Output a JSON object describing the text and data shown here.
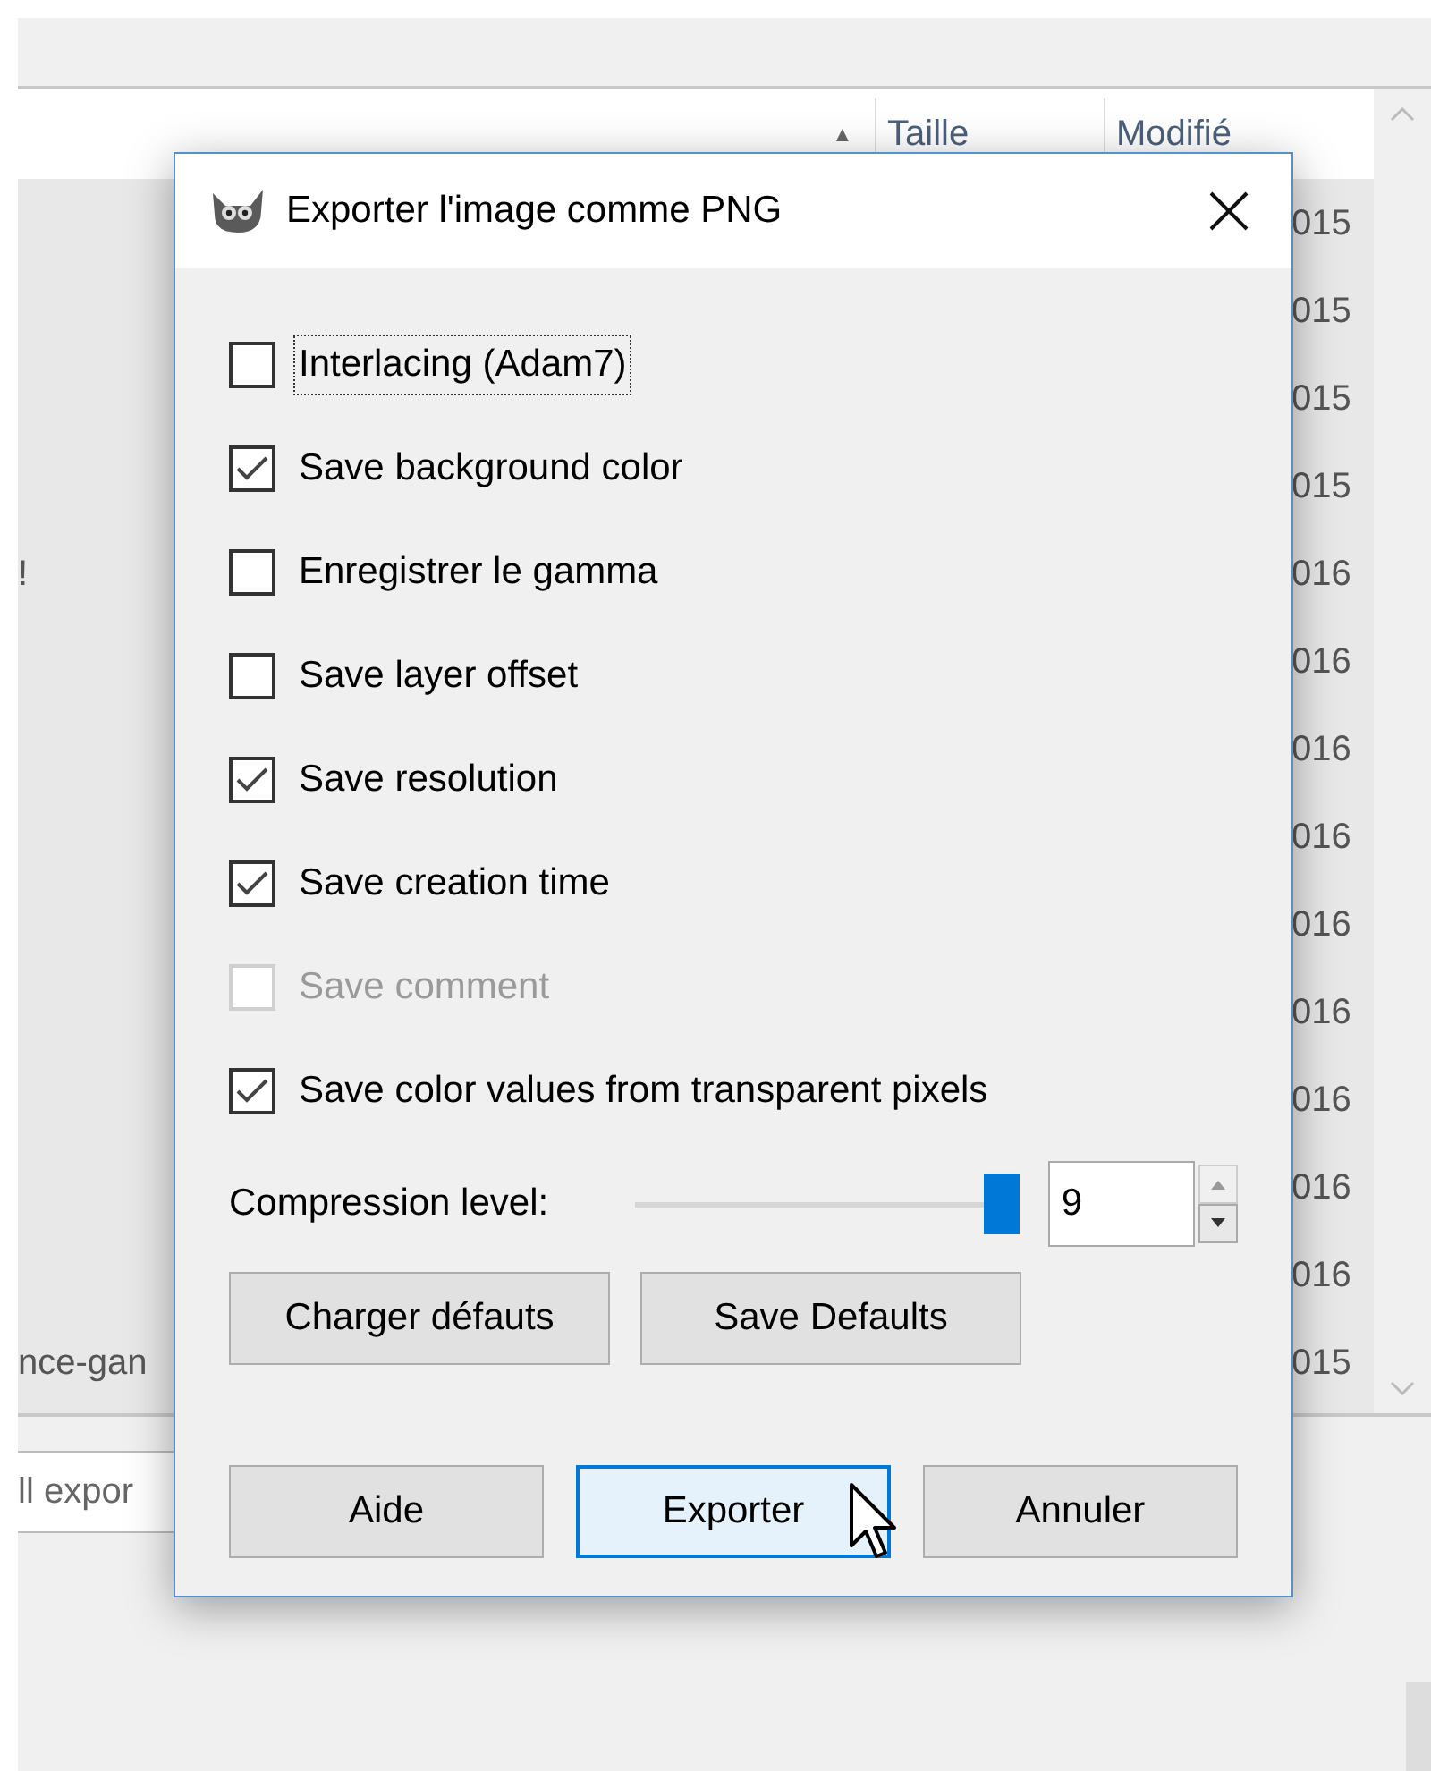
{
  "file_list": {
    "sort_arrow": "▲",
    "columns": [
      "Taille",
      "Modifié"
    ],
    "rows": [
      {
        "date": "015"
      },
      {
        "date": "015"
      },
      {
        "date": "015"
      },
      {
        "date": "015"
      },
      {
        "name": "!",
        "date": "016"
      },
      {
        "date": "016"
      },
      {
        "date": "016"
      },
      {
        "date": "016"
      },
      {
        "date": "016"
      },
      {
        "date": "016"
      },
      {
        "date": "016"
      },
      {
        "date": "016"
      },
      {
        "date": "016"
      },
      {
        "name": "nce-gan",
        "date": "015"
      }
    ],
    "filter_field": {
      "value": "ll expor"
    }
  },
  "dialog": {
    "title": "Exporter l'image comme PNG",
    "options": [
      {
        "label": "Interlacing (Adam7)",
        "checked": false,
        "disabled": false,
        "focused": true
      },
      {
        "label": "Save background color",
        "checked": true,
        "disabled": false,
        "focused": false
      },
      {
        "label": "Enregistrer le gamma",
        "checked": false,
        "disabled": false,
        "focused": false
      },
      {
        "label": "Save layer offset",
        "checked": false,
        "disabled": false,
        "focused": false
      },
      {
        "label": "Save resolution",
        "checked": true,
        "disabled": false,
        "focused": false
      },
      {
        "label": "Save creation time",
        "checked": true,
        "disabled": false,
        "focused": false
      },
      {
        "label": "Save comment",
        "checked": false,
        "disabled": true,
        "focused": false
      },
      {
        "label": "Save color values from transparent pixels",
        "checked": true,
        "disabled": false,
        "focused": false
      }
    ],
    "compression": {
      "label": "Compression level:",
      "level": 1,
      "value": "9"
    },
    "defaults_buttons": [
      "Charger défauts",
      "Save Defaults"
    ],
    "actions": [
      {
        "label": "Aide",
        "focused": false
      },
      {
        "label": "Exporter",
        "focused": true
      },
      {
        "label": "Annuler",
        "focused": false
      }
    ]
  }
}
